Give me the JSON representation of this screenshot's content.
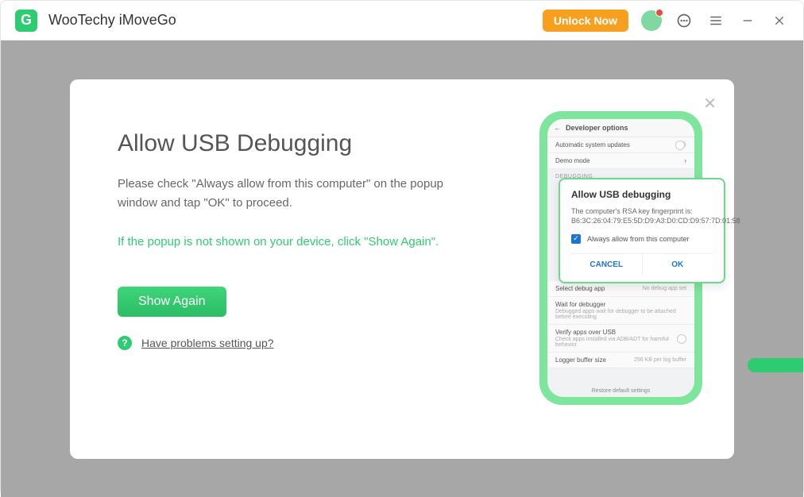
{
  "titlebar": {
    "app_name": "WooTechy iMoveGo",
    "logo_letter": "G",
    "unlock_label": "Unlock Now"
  },
  "modal": {
    "heading": "Allow USB Debugging",
    "instruction": "Please check \"Always allow from this computer\" on the popup window and tap \"OK\" to proceed.",
    "hint": "If the popup is not shown on your device, click \"Show Again\".",
    "show_again_label": "Show Again",
    "help_link": "Have problems setting up?"
  },
  "phone": {
    "header": "Developer options",
    "row_auto_update": "Automatic system updates",
    "row_demo": "Demo mode",
    "section_debugging": "DEBUGGING",
    "row_select_debug": "Select debug app",
    "row_select_debug_sub": "No debug app set",
    "row_wait": "Wait for debugger",
    "row_wait_sub": "Debugged apps wait for debugger to be attached before executing",
    "row_verify": "Verify apps over USB",
    "row_verify_sub": "Check apps installed via ADB/ADT for harmful behavior",
    "row_logger": "Logger buffer size",
    "row_logger_sub": "256 KB per log buffer",
    "footer": "Restore default settings"
  },
  "android_popup": {
    "title": "Allow USB debugging",
    "body_line1": "The computer's RSA key fingerprint is:",
    "body_line2": "B6:3C:26:04:79:E5:5D:D9:A3:D0:CD:D9:57:7D:01:58",
    "checkbox_label": "Always allow from this computer",
    "cancel": "CANCEL",
    "ok": "OK"
  }
}
